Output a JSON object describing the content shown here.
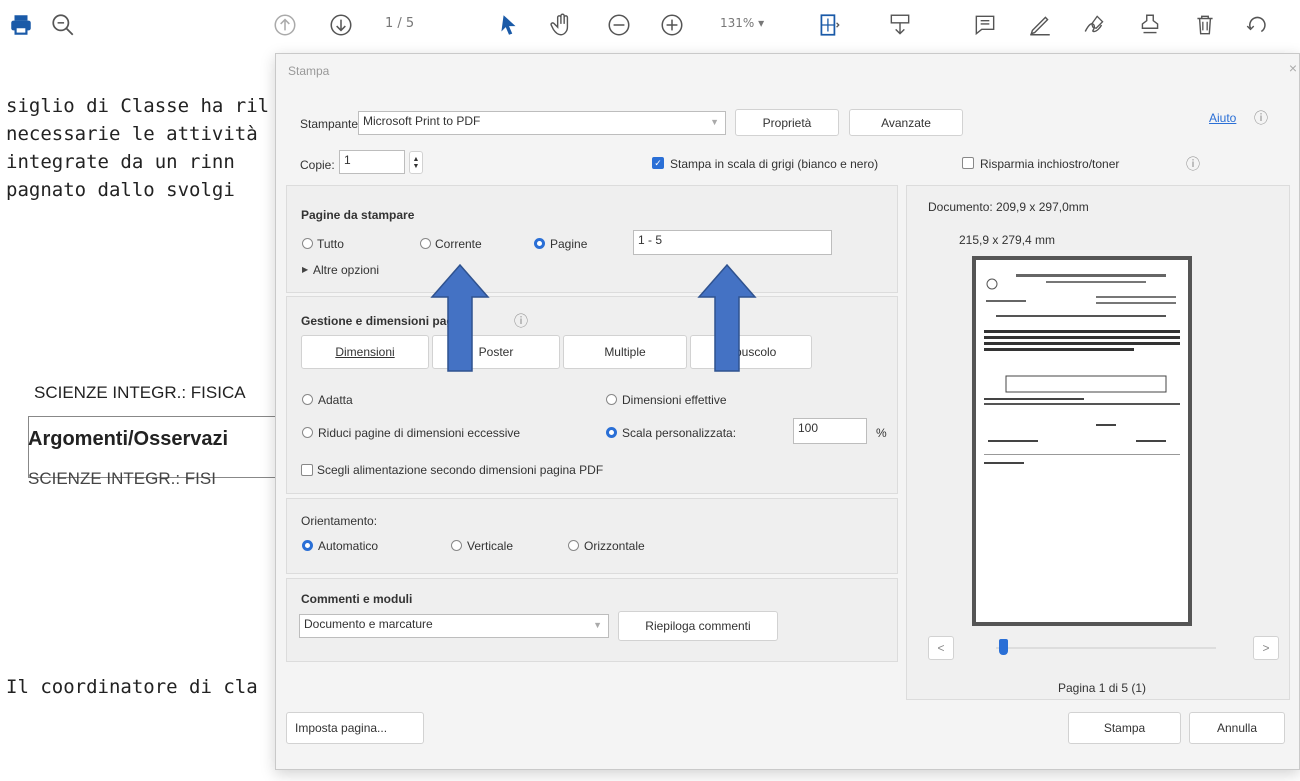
{
  "toolbar": {
    "page_indicator": "1  / 5",
    "zoom_level": "131%  ▾"
  },
  "document": {
    "lines": [
      "siglio di Classe ha ril",
      "necessarie le attività",
      " integrate da un rinn",
      "pagnato dallo svolgi"
    ],
    "box_text": "SCIENZE INTEGR.: FISICA",
    "heading": "Argomenti/Osservazi",
    "subject": "SCIENZE INTEGR.: FISI",
    "coordinator": "Il coordinatore di cla"
  },
  "dialog": {
    "title": "Stampa",
    "close": "×",
    "help_link": "Aiuto",
    "printer_label": "Stampante:",
    "printer_value": "Microsoft Print to PDF",
    "properties_button": "Proprietà",
    "advanced_button": "Avanzate",
    "copies_label": "Copie:",
    "copies_value": "1",
    "grayscale_label": "Stampa in scala di grigi (bianco e nero)",
    "grayscale_checked": true,
    "save_ink_label": "Risparmia inchiostro/toner",
    "save_ink_checked": false,
    "pages_section": {
      "title": "Pagine da stampare",
      "all": "Tutto",
      "current": "Corrente",
      "pages": "Pagine",
      "pages_value": "1 - 5",
      "more_options": "Altre opzioni"
    },
    "sizing_section": {
      "title": "Gestione e dimensioni pagina",
      "btn_size": "Dimensioni",
      "btn_poster": "Poster",
      "btn_multiple": "Multiple",
      "btn_booklet": "Opuscolo",
      "fit": "Adatta",
      "actual_size": "Dimensioni effettive",
      "shrink": "Riduci pagine di dimensioni eccessive",
      "custom_scale": "Scala personalizzata:",
      "custom_scale_value": "100",
      "percent": "%",
      "paper_source": "Scegli alimentazione secondo dimensioni pagina PDF"
    },
    "orientation_section": {
      "title": "Orientamento:",
      "auto": "Automatico",
      "vertical": "Verticale",
      "horizontal": "Orizzontale"
    },
    "comments_section": {
      "title": "Commenti e moduli",
      "select_value": "Documento e marcature",
      "summarize_button": "Riepiloga commenti"
    },
    "preview": {
      "document_size": "Documento: 209,9 x 297,0mm",
      "paper_size": "215,9 x 279,4 mm",
      "prev": "<",
      "next": ">",
      "page_status": "Pagina 1 di 5 (1)"
    },
    "page_setup_button": "Imposta pagina...",
    "print_button": "Stampa",
    "cancel_button": "Annulla"
  },
  "colors": {
    "accent": "#2a6fd6",
    "overlay_arrow": "#4472c4",
    "toolbar_icon": "#1a5aa8"
  }
}
